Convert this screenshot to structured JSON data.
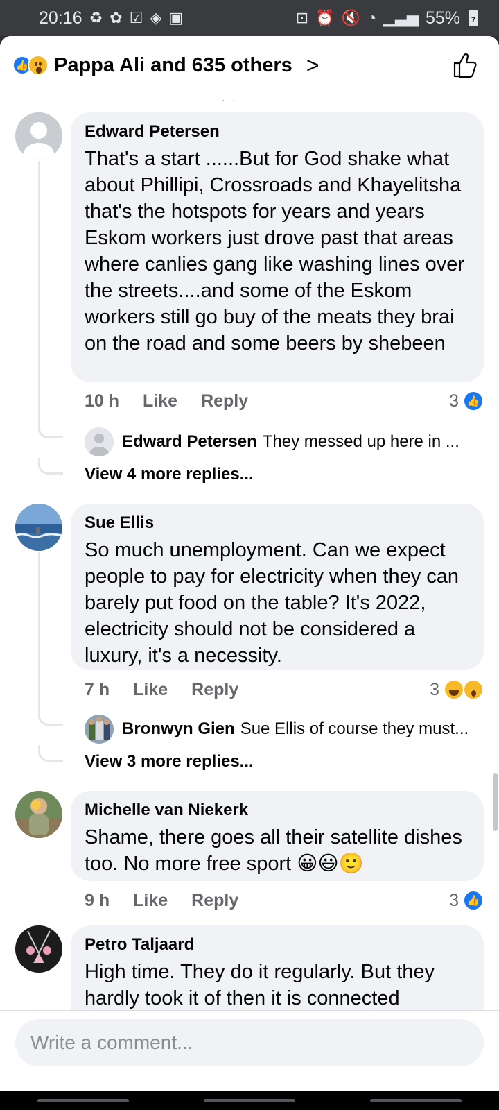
{
  "status_bar": {
    "time": "20:16",
    "battery_percent": "55%",
    "battery_badge": "7"
  },
  "header": {
    "title": "Pappa Ali and 635 others",
    "chevron": ">"
  },
  "comments": [
    {
      "author": "Edward Petersen",
      "text": "That's a start ......But for God shake what about Phillipi, Crossroads and Khayelitsha that's the hotspots for years and years Eskom workers just drove past that areas where canlies gang like washing lines over the streets....and some of the Eskom workers still go buy of the meats they brai on the road and some beers by shebeen",
      "time": "10 h",
      "like_label": "Like",
      "reply_label": "Reply",
      "reaction_count": "3",
      "reply_preview": {
        "author": "Edward Petersen",
        "text": "They messed up here in ..."
      },
      "more_replies": "View 4 more replies..."
    },
    {
      "author": "Sue Ellis",
      "text": "So much unemployment. Can we expect people to pay for electricity when they can barely put food on the table? It's 2022, electricity should not be considered a luxury, it's a necessity.",
      "time": "7 h",
      "like_label": "Like",
      "reply_label": "Reply",
      "reaction_count": "3",
      "reply_preview": {
        "author": "Bronwyn Gien",
        "text": "Sue Ellis of course they must..."
      },
      "more_replies": "View 3 more replies..."
    },
    {
      "author": "Michelle van Niekerk",
      "text": "Shame, there goes all their satellite dishes too. No more free sport 😀😃🙂",
      "time": "9 h",
      "like_label": "Like",
      "reply_label": "Reply",
      "reaction_count": "3"
    },
    {
      "author": "Petro Taljaard",
      "text": "High time. They do it regularly. But they hardly took it of then it is connected"
    }
  ],
  "composer": {
    "placeholder": "Write a comment..."
  }
}
